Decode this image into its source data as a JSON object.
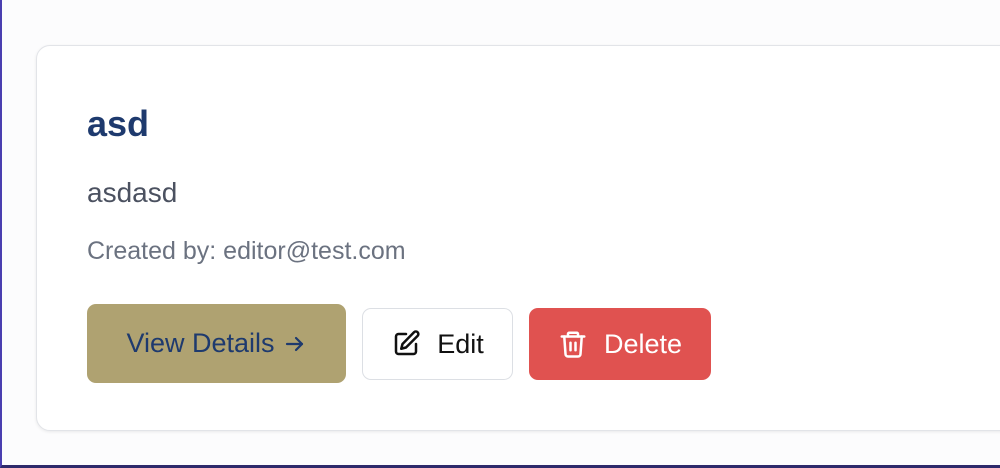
{
  "card": {
    "title": "asd",
    "description": "asdasd",
    "created_by": "Created by: editor@test.com"
  },
  "actions": {
    "view_label": "View Details",
    "edit_label": "Edit",
    "delete_label": "Delete"
  },
  "icons": {
    "view": "arrow-right-icon",
    "edit": "pencil-square-icon",
    "delete": "trash-icon"
  },
  "colors": {
    "title": "#1e3a6e",
    "view_button_bg": "#afa271",
    "delete_button_bg": "#e05250",
    "page_accent_border": "#4a3fb0"
  }
}
